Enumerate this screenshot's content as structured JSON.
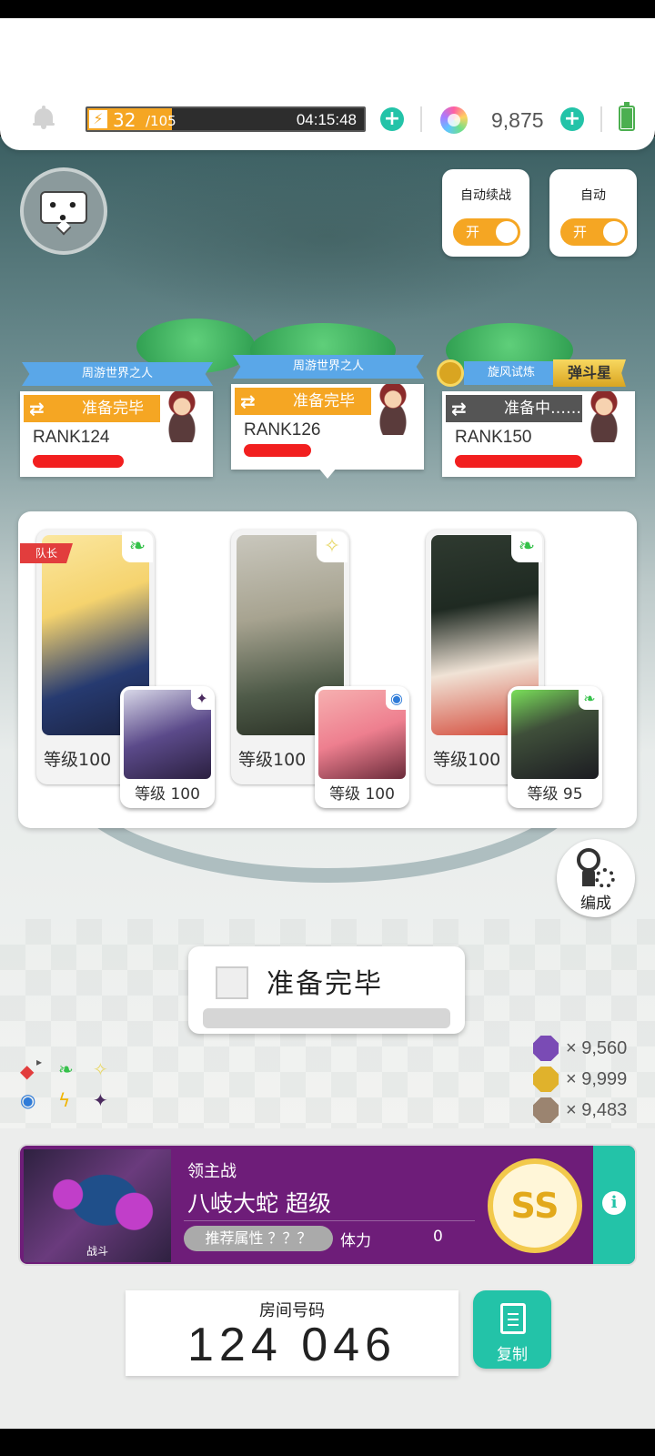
{
  "status": {
    "stamina_current": "32",
    "stamina_max": "/105",
    "stamina_level": 0.305,
    "stamina_timer": "04:15:48",
    "gems": "9,875"
  },
  "toggles": [
    {
      "label": "自动续战",
      "state": "开"
    },
    {
      "label": "自动",
      "state": "开"
    }
  ],
  "players": [
    {
      "title": "周游世界之人",
      "status": "准备完毕",
      "rank": "RANK124"
    },
    {
      "title": "周游世界之人",
      "status": "准备完毕",
      "rank": "RANK126"
    },
    {
      "title": "旋风试炼",
      "title_badge": "弹斗星",
      "status": "准备中……",
      "rank": "RANK150"
    }
  ],
  "team": {
    "captain_label": "队长",
    "heroes": [
      {
        "level": "等级100",
        "element": "green",
        "sub_level": "等级 100",
        "sub_element": "dark"
      },
      {
        "level": "等级100",
        "element": "light",
        "sub_level": "等级 100",
        "sub_element": "blue"
      },
      {
        "level": "等级100",
        "element": "green",
        "sub_level": "等级 95",
        "sub_element": "green"
      }
    ]
  },
  "formation_label": "编成",
  "ready_button_label": "准备完毕",
  "resources": [
    {
      "icon": "purple-medal-icon",
      "value": "× 9,560"
    },
    {
      "icon": "gold-medal-icon",
      "value": "× 9,999"
    },
    {
      "icon": "bronze-medal-icon",
      "value": "× 9,483"
    }
  ],
  "boss": {
    "category": "领主战",
    "name": "八岐大蛇 超级",
    "recommended": "推荐属性 ？？？",
    "stamina_label": "体力",
    "stamina_value": "0",
    "art_tag": "战斗",
    "rank_badge": "SS"
  },
  "room": {
    "label": "房间号码",
    "code": "124 046",
    "copy_label": "复制"
  }
}
